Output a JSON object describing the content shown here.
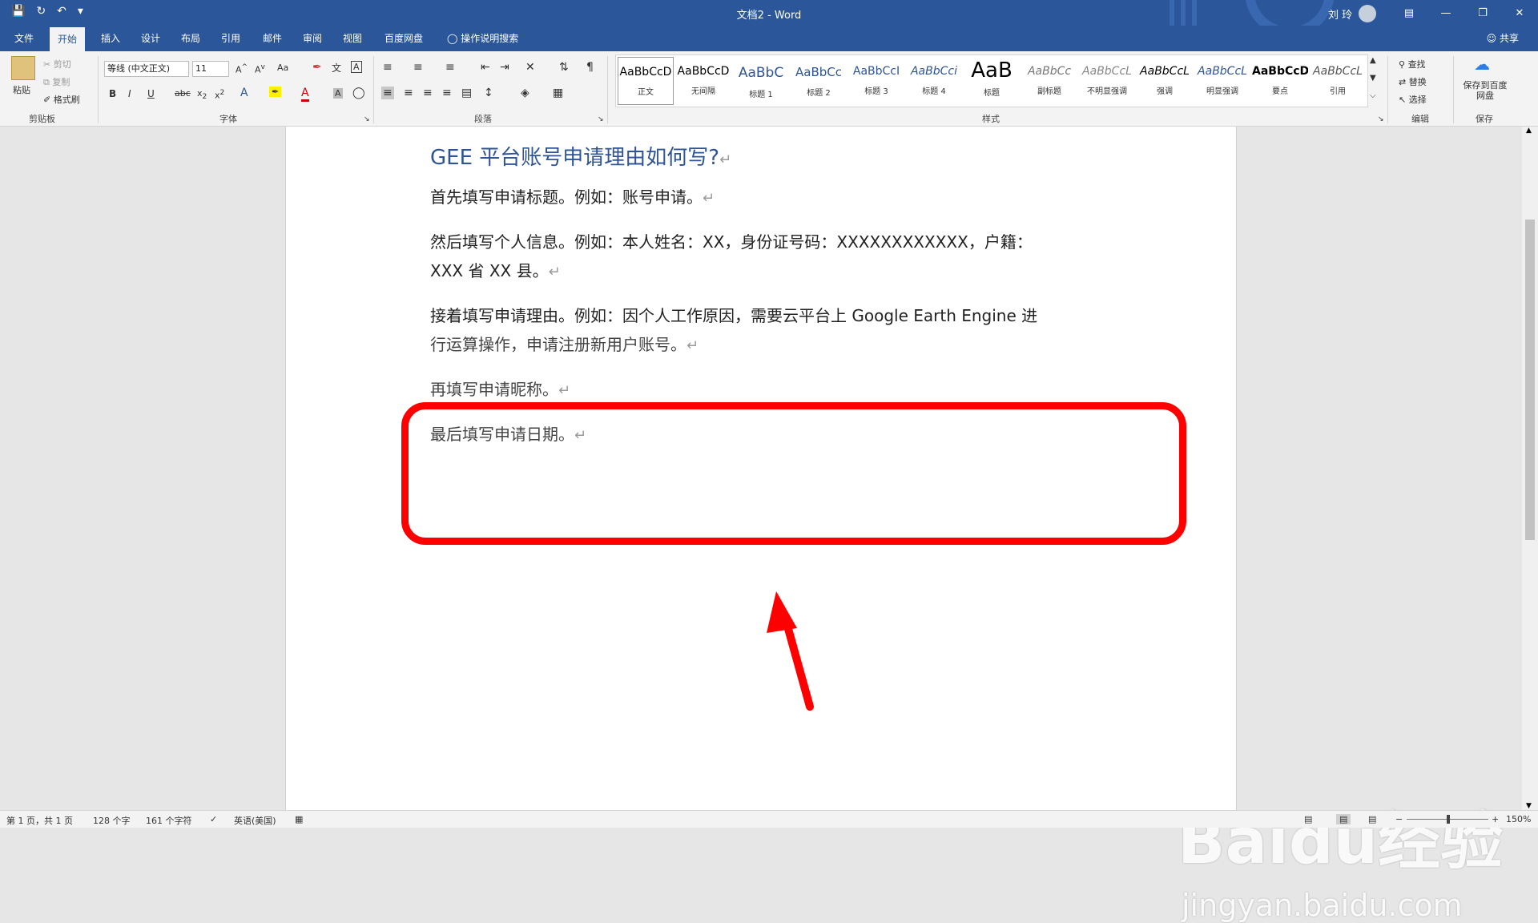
{
  "window": {
    "doc_title": "文档2 - Word",
    "user": "刘 玲"
  },
  "tabs": [
    "文件",
    "开始",
    "插入",
    "设计",
    "布局",
    "引用",
    "邮件",
    "审阅",
    "视图",
    "百度网盘"
  ],
  "active_tab": "开始",
  "tell_me": "操作说明搜索",
  "share": "共享",
  "clipboard": {
    "paste": "粘贴",
    "cut": "剪切",
    "copy": "复制",
    "format_painter": "格式刷",
    "label": "剪贴板"
  },
  "font": {
    "name": "等线 (中文正文)",
    "size": "11",
    "label": "字体",
    "case": "Aa"
  },
  "paragraph": {
    "label": "段落"
  },
  "styles": {
    "label": "样式",
    "items": [
      {
        "sample": "AaBbCcD",
        "name": "正文"
      },
      {
        "sample": "AaBbCcD",
        "name": "无间隔"
      },
      {
        "sample": "AaBbC",
        "name": "标题 1"
      },
      {
        "sample": "AaBbCc",
        "name": "标题 2"
      },
      {
        "sample": "AaBbCcI",
        "name": "标题 3"
      },
      {
        "sample": "AaBbCci",
        "name": "标题 4"
      },
      {
        "sample": "AaB",
        "name": "标题"
      },
      {
        "sample": "AaBbCc",
        "name": "副标题"
      },
      {
        "sample": "AaBbCcL",
        "name": "不明显强调"
      },
      {
        "sample": "AaBbCcL",
        "name": "强调"
      },
      {
        "sample": "AaBbCcL",
        "name": "明显强调"
      },
      {
        "sample": "AaBbCcD",
        "name": "要点"
      },
      {
        "sample": "AaBbCcL",
        "name": "引用"
      }
    ]
  },
  "editing": {
    "find": "查找",
    "replace": "替换",
    "select": "选择",
    "label": "编辑"
  },
  "save": {
    "button": "保存到百度网盘",
    "label": "保存"
  },
  "document": {
    "heading": "GEE 平台账号申请理由如何写?",
    "lines": [
      "首先填写申请标题。例如：账号申请。",
      "然后填写个人信息。例如：本人姓名：XX，身份证号码：XXXXXXXXXXXX，户籍：",
      "XXX 省 XX 县。",
      "接着填写申请理由。例如：因个人工作原因，需要云平台上 Google Earth Engine 进",
      "行运算操作，申请注册新用户账号。",
      "再填写申请昵称。",
      "最后填写申请日期。"
    ]
  },
  "status": {
    "page": "第 1 页，共 1 页",
    "words": "128 个字",
    "chars": "161 个字符",
    "language": "英语(美国)",
    "zoom": "150%"
  },
  "watermark": {
    "brand": "Baidu经验",
    "url": "jingyan.baidu.com"
  }
}
